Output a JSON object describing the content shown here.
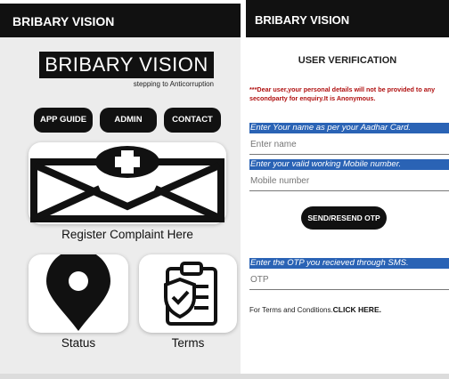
{
  "left_screen": {
    "app_title": "BRIBARY VISION",
    "logo_text": "BRIBARY VISION",
    "tagline": "stepping to Anticorruption",
    "nav": {
      "app_guide": "APP GUIDE",
      "admin": "ADMIN",
      "contact": "CONTACT"
    },
    "register_label": "Register Complaint Here",
    "status_label": "Status",
    "terms_label": "Terms"
  },
  "right_screen": {
    "app_title": "BRIBARY VISION",
    "title": "USER VERIFICATION",
    "warning": "***Dear user,your personal details will not be provided to any secondparty for enquiry.It is Anonymous.",
    "name_hint": "Enter Your name as per your Aadhar Card.",
    "name_placeholder": "Enter name",
    "mobile_hint": "Enter your valid working Mobile number.",
    "mobile_placeholder": "Mobile number",
    "otp_button": "SEND/RESEND OTP",
    "otp_hint": "Enter the OTP you recieved through SMS.",
    "otp_placeholder": "OTP",
    "terms_text": "For Terms and Conditions.",
    "terms_link": "CLICK HERE."
  },
  "colors": {
    "appbar": "#111111",
    "hint_bg": "#2a63b5",
    "warning": "#b01010"
  }
}
